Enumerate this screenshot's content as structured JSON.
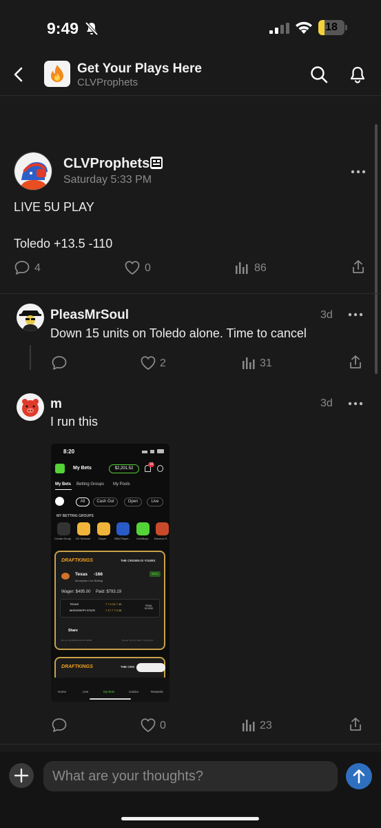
{
  "status_bar": {
    "time": "9:49",
    "battery": "18"
  },
  "header": {
    "title": "Get Your Plays Here",
    "subtitle": "CLVProphets"
  },
  "post": {
    "author": "CLVProphets",
    "timestamp": "Saturday 5:33 PM",
    "line1": "LIVE 5U PLAY",
    "line2": "Toledo +13.5 -110",
    "comments": "4",
    "likes": "0",
    "views": "86"
  },
  "replies": [
    {
      "author": "PleasMrSoul",
      "age": "3d",
      "text": "Down 15 units on Toledo alone. Time to cancel",
      "likes": "2",
      "views": "31"
    },
    {
      "author": "m",
      "age": "3d",
      "text": "I run this",
      "likes": "0",
      "views": "23"
    }
  ],
  "embedded_screenshot": {
    "time": "8:20",
    "title": "My Bets",
    "balance": "$2,201.52",
    "notif_count": "16",
    "tabs": [
      "My Bets",
      "Betting Groups",
      "My Pools"
    ],
    "filters": [
      "All",
      "Cash Out",
      "Open",
      "Live"
    ],
    "groups_heading": "MY BETTING GROUPS",
    "groups": [
      "Create Group",
      "DK Network",
      "Dwyer",
      "NBA Player...",
      "GoldBoys",
      "Barstool S"
    ],
    "brand": "DRAFTKINGS",
    "crown": "THE CROWN IS YOURS",
    "crown_short": "THE CRO",
    "bet_team": "Texas",
    "bet_odds": "-166",
    "bet_type": "Moneyline Live Betting",
    "status": "Won",
    "wager": "Wager: $495.00",
    "paid": "Paid: $793.19",
    "team1": "TEXAS",
    "team2": "MISSISSIPPI STATE",
    "score1": "7  7  0  24  7  45",
    "score2": "7  17  7  7  0  38",
    "final": "FINAL SCORE",
    "share": "Share",
    "bet_id": "Bet ID: DK638697525126702882",
    "placed": "Placed: Oct 25, 2025, 7:34:40 PM",
    "nav": [
      "Home",
      "Live",
      "My Bets",
      "Casino",
      "Rewards"
    ]
  },
  "composer": {
    "placeholder": "What are your thoughts?"
  },
  "colors": {
    "background": "#1a1a1a",
    "accent_blue": "#2f6fbf",
    "dk_green": "#53d337",
    "gold": "#c9a24a"
  }
}
